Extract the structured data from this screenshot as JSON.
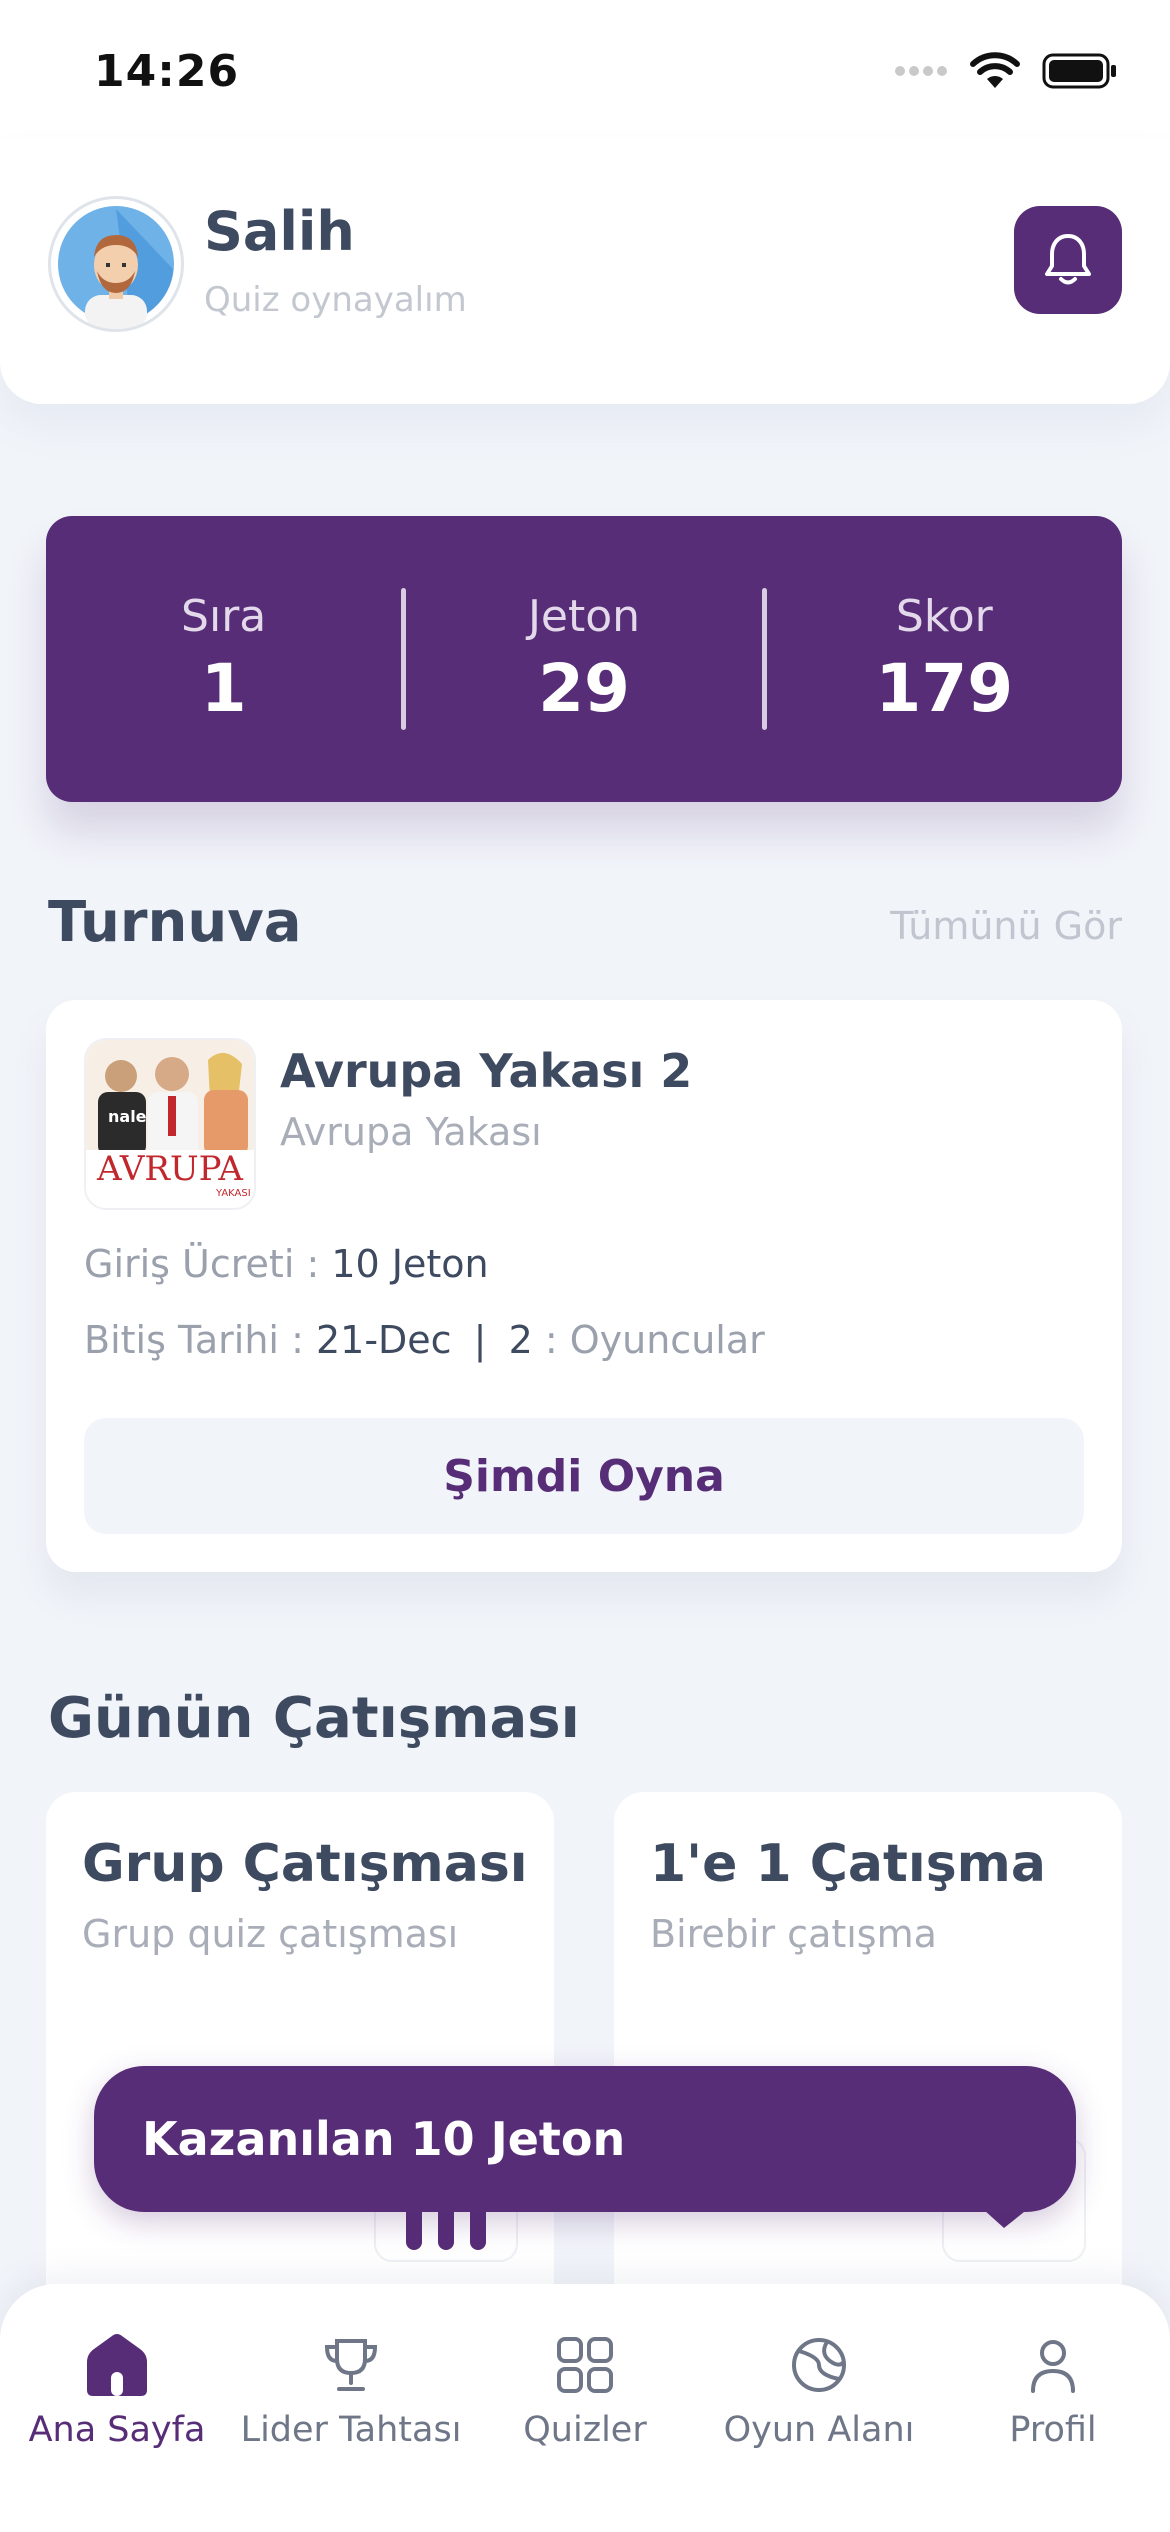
{
  "status": {
    "time": "14:26"
  },
  "header": {
    "name": "Salih",
    "subtitle": "Quiz oynayalım"
  },
  "stats": [
    {
      "label": "Sıra",
      "value": "1"
    },
    {
      "label": "Jeton",
      "value": "29"
    },
    {
      "label": "Skor",
      "value": "179"
    }
  ],
  "tournament_section": {
    "title": "Turnuva",
    "see_all": "Tümünü Gör",
    "card": {
      "name": "Avrupa Yakası 2",
      "category": "Avrupa Yakası",
      "thumb_text": "AVRUPA",
      "thumb_logo": "nale",
      "thumb_small": "YAKASI",
      "entry_label": "Giriş Ücreti :",
      "entry_value": "10 Jeton",
      "end_label": "Bitiş Tarihi :",
      "end_value": "21-Dec",
      "separator": "|",
      "players_count": "2",
      "players_label": ": Oyuncular",
      "play_button": "Şimdi Oyna"
    }
  },
  "duel_section": {
    "title": "Günün Çatışması",
    "cards": [
      {
        "title": "Grup Çatışması",
        "subtitle": "Grup quiz çatışması"
      },
      {
        "title": "1'e 1 Çatışma",
        "subtitle": "Birebir çatışma"
      }
    ]
  },
  "toast": {
    "text": "Kazanılan 10 Jeton"
  },
  "nav": {
    "items": [
      {
        "label": "Ana Sayfa",
        "icon": "home-icon",
        "active": true
      },
      {
        "label": "Lider Tahtası",
        "icon": "trophy-icon",
        "active": false
      },
      {
        "label": "Quizler",
        "icon": "grid-icon",
        "active": false
      },
      {
        "label": "Oyun Alanı",
        "icon": "ball-icon",
        "active": false
      },
      {
        "label": "Profil",
        "icon": "user-icon",
        "active": false
      }
    ]
  },
  "colors": {
    "primary": "#572d77",
    "background": "#f1f4f9",
    "text": "#3e4a60",
    "muted": "#a8adb8"
  }
}
